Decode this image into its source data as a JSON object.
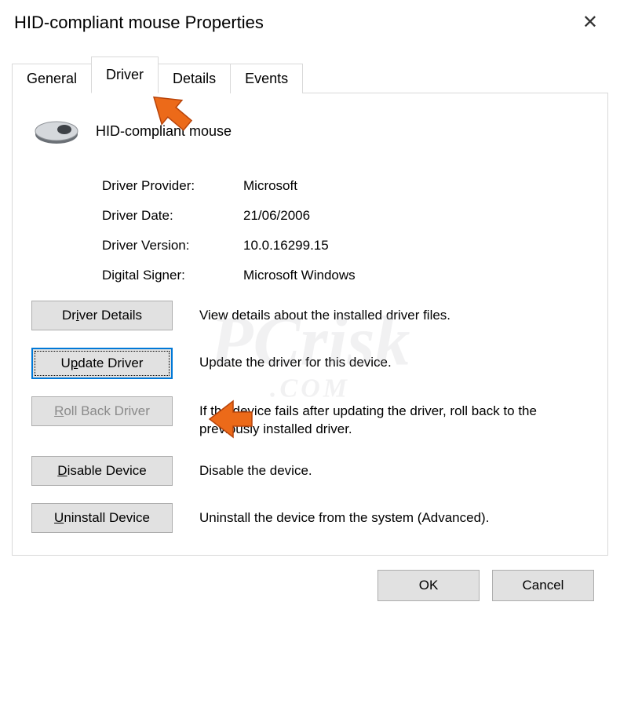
{
  "title": "HID-compliant mouse Properties",
  "tabs": {
    "general": "General",
    "driver": "Driver",
    "details": "Details",
    "events": "Events"
  },
  "device_name": "HID-compliant mouse",
  "info": {
    "provider_label": "Driver Provider:",
    "provider_value": "Microsoft",
    "date_label": "Driver Date:",
    "date_value": "21/06/2006",
    "version_label": "Driver Version:",
    "version_value": "10.0.16299.15",
    "signer_label": "Digital Signer:",
    "signer_value": "Microsoft Windows"
  },
  "buttons": {
    "details": {
      "pre": "Dr",
      "u": "i",
      "post": "ver Details",
      "desc": "View details about the installed driver files."
    },
    "update": {
      "pre": "U",
      "u": "p",
      "post": "date Driver",
      "desc": "Update the driver for this device."
    },
    "rollback": {
      "pre": "",
      "u": "R",
      "post": "oll Back Driver",
      "desc": "If the device fails after updating the driver, roll back to the previously installed driver."
    },
    "disable": {
      "pre": "",
      "u": "D",
      "post": "isable Device",
      "desc": "Disable the device."
    },
    "uninstall": {
      "pre": "",
      "u": "U",
      "post": "ninstall Device",
      "desc": "Uninstall the device from the system (Advanced)."
    }
  },
  "footer": {
    "ok": "OK",
    "cancel": "Cancel"
  }
}
